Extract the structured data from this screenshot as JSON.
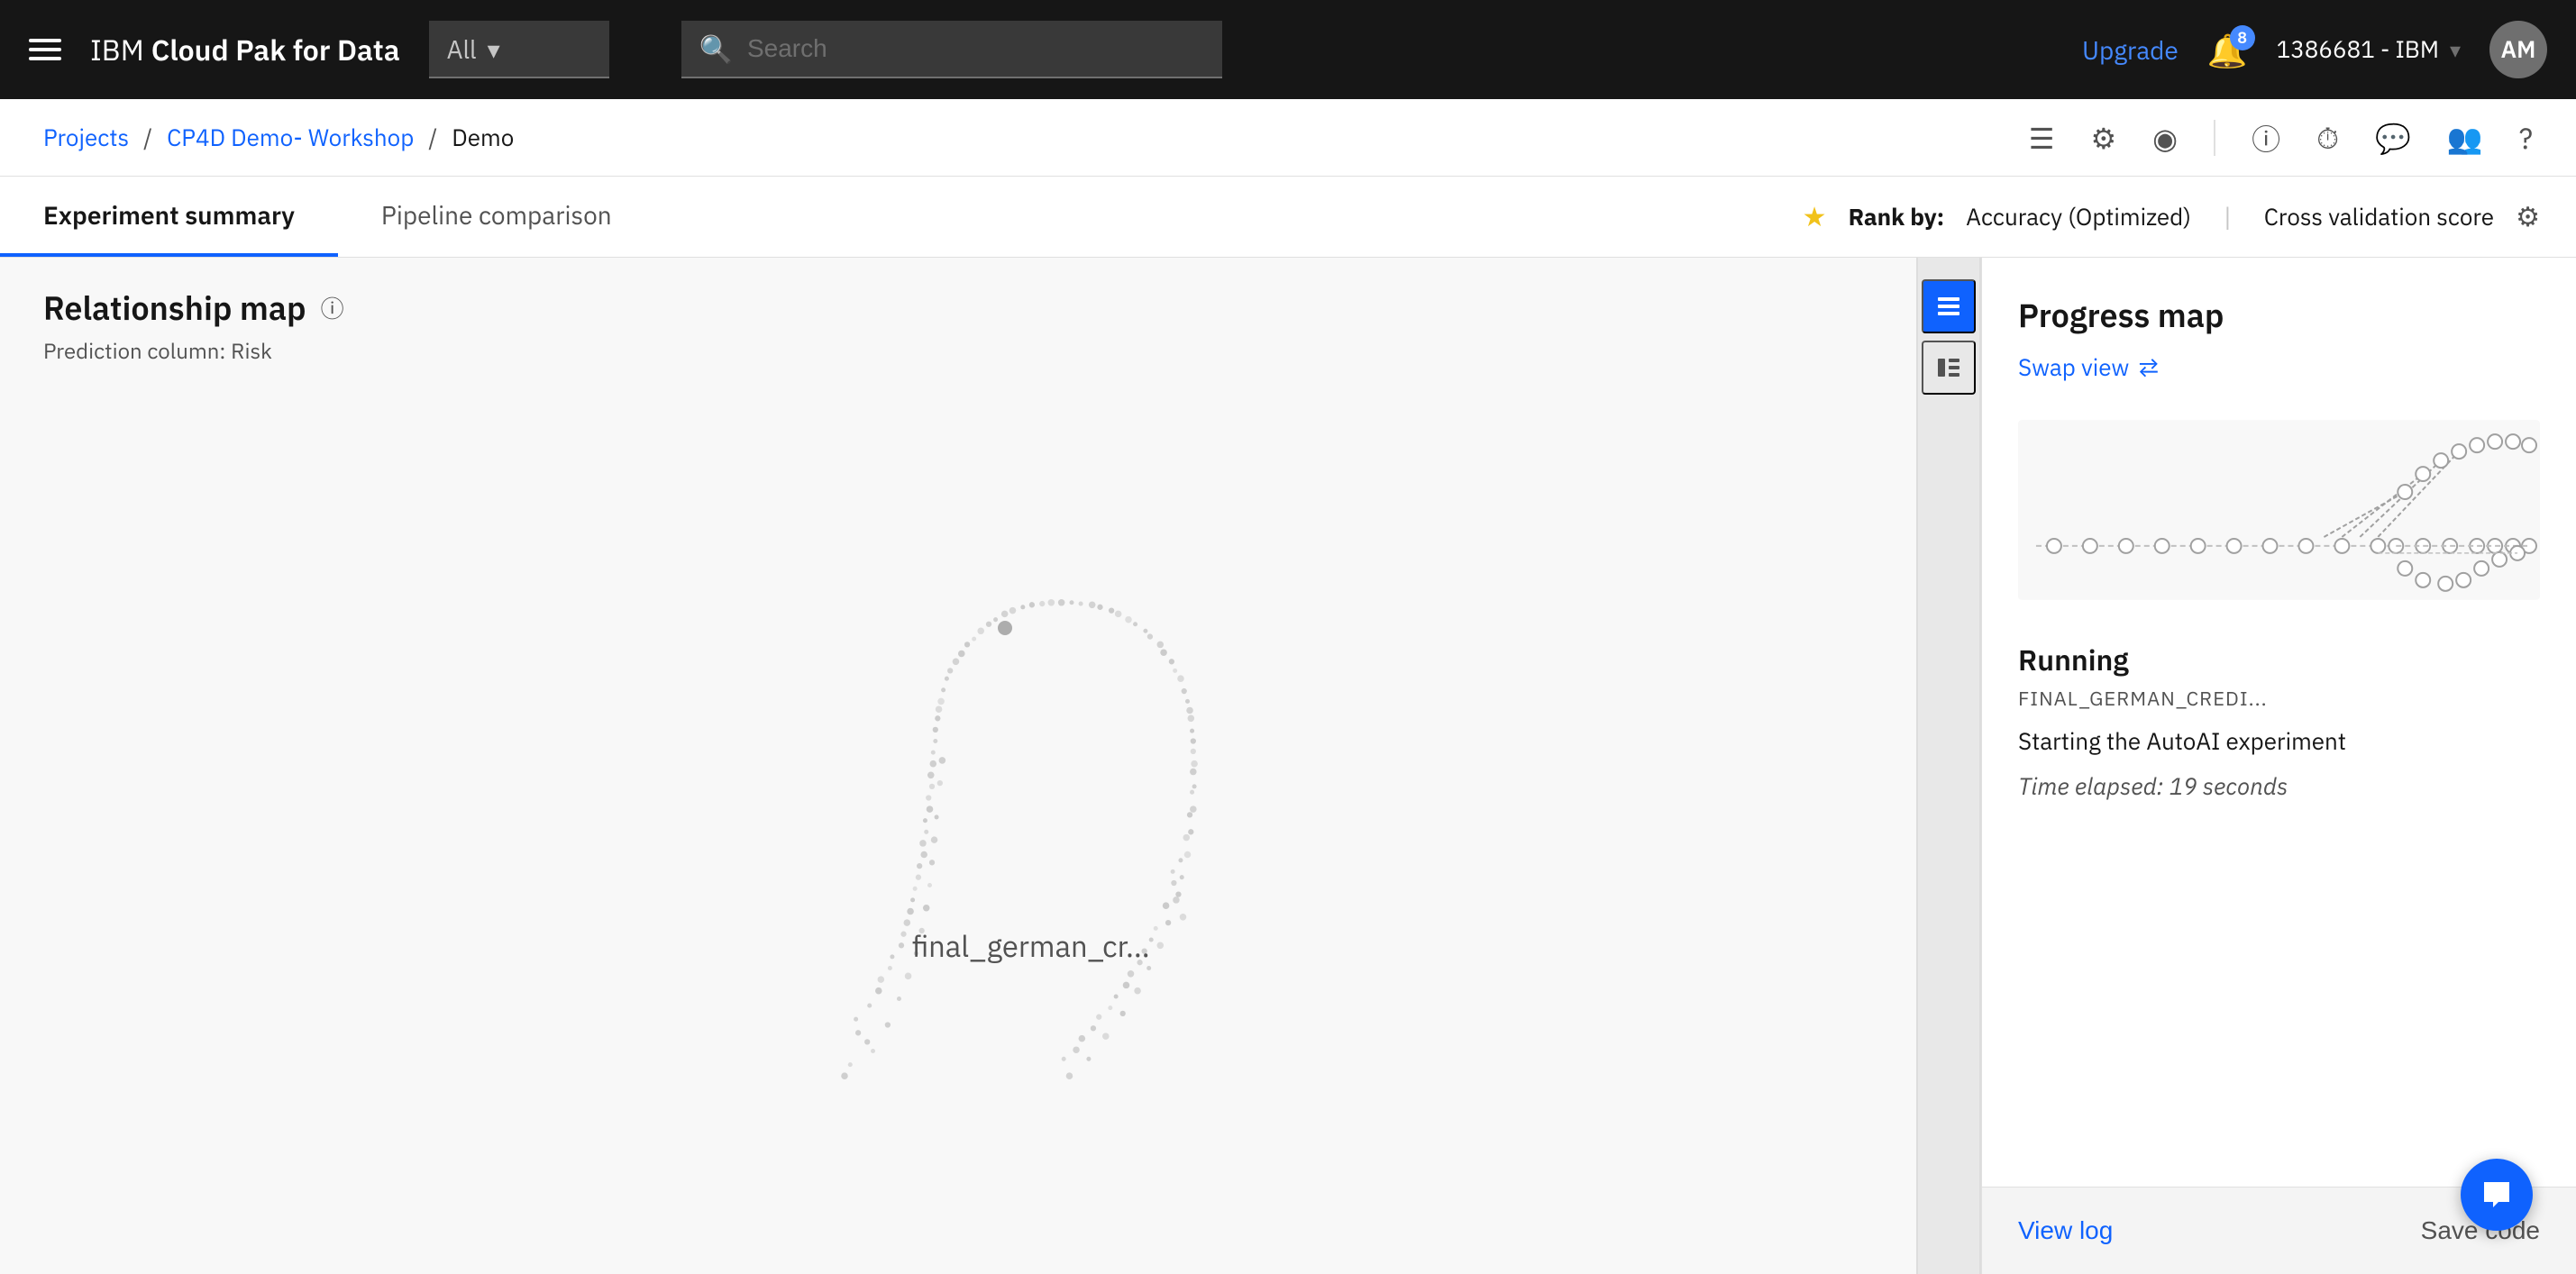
{
  "topnav": {
    "brand_ibm": "IBM",
    "brand_name": "Cloud Pak for Data",
    "filter_label": "All",
    "search_placeholder": "Search",
    "upgrade_label": "Upgrade",
    "notif_count": "8",
    "account_label": "1386681 - IBM",
    "avatar_initials": "AM"
  },
  "breadcrumb": {
    "project_label": "Projects",
    "workshop_label": "CP4D Demo- Workshop",
    "current_label": "Demo"
  },
  "tabs": {
    "tab1_label": "Experiment summary",
    "tab2_label": "Pipeline comparison",
    "rank_by_label": "Rank by:",
    "rank_val": "Accuracy (Optimized)",
    "rank_sep": "|",
    "rank_cv": "Cross validation score"
  },
  "relationship_map": {
    "title": "Relationship map",
    "subtitle_prefix": "Prediction column:",
    "subtitle_val": "Risk",
    "vis_label": "final_german_cr..."
  },
  "right_panel": {
    "progress_map_title": "Progress map",
    "swap_view_label": "Swap view",
    "running_title": "Running",
    "running_file": "FINAL_GERMAN_CREDI...",
    "running_desc": "Starting the AutoAI experiment",
    "time_elapsed": "Time elapsed: 19 seconds"
  },
  "footer": {
    "view_log_label": "View log",
    "save_code_label": "Save code"
  },
  "icons": {
    "hamburger": "☰",
    "search": "🔍",
    "chevron_down": "▾",
    "bell": "🔔",
    "calendar": "📅",
    "gear": "⚙",
    "target": "◎",
    "info": "ⓘ",
    "history": "⏱",
    "chat": "💬",
    "users": "👥",
    "help": "?",
    "list": "≡",
    "filter_list": "⊟",
    "swap": "⇄",
    "settings": "⚙"
  }
}
